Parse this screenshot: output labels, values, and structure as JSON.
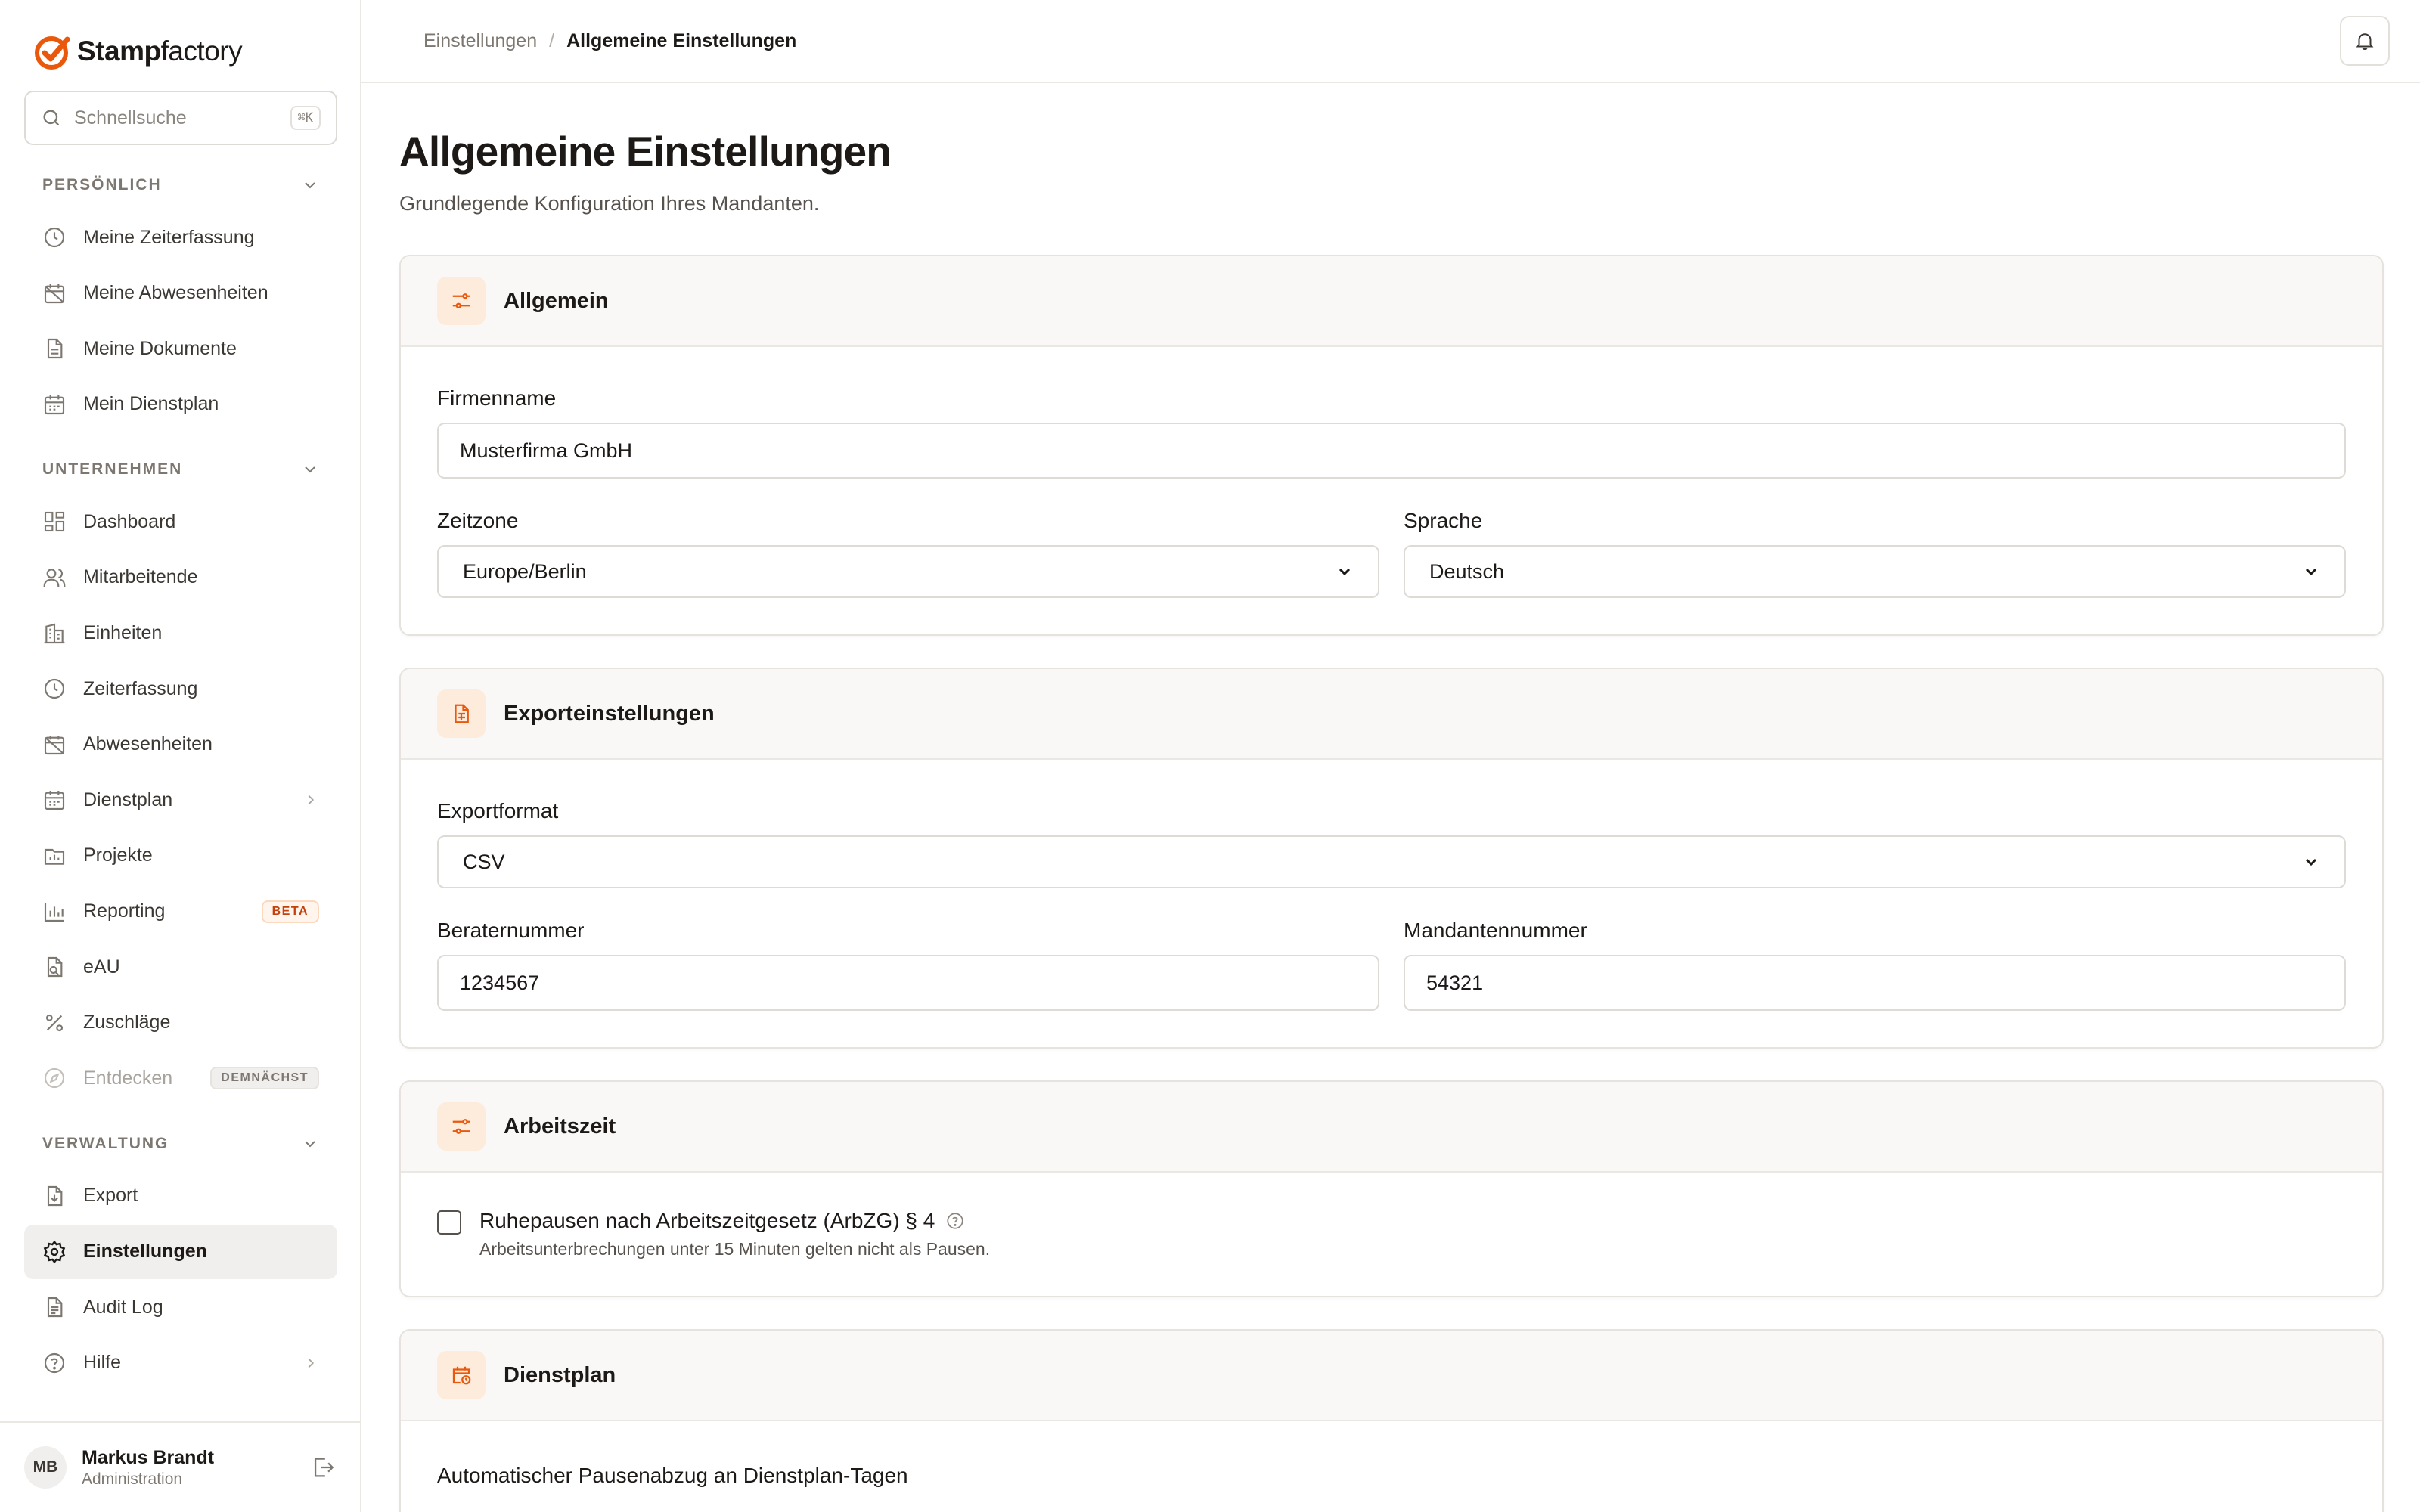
{
  "brand": {
    "name_bold": "Stamp",
    "name_light": "factory",
    "accent": "#ea580c"
  },
  "search": {
    "placeholder": "Schnellsuche",
    "shortcut": "⌘K"
  },
  "sidebar": {
    "sections": [
      {
        "title": "PERSÖNLICH",
        "items": [
          {
            "label": "Meine Zeiterfassung",
            "icon": "clock-icon"
          },
          {
            "label": "Meine Abwesenheiten",
            "icon": "calendar-off-icon"
          },
          {
            "label": "Meine Dokumente",
            "icon": "document-icon"
          },
          {
            "label": "Mein Dienstplan",
            "icon": "calendar-icon"
          }
        ]
      },
      {
        "title": "UNTERNEHMEN",
        "items": [
          {
            "label": "Dashboard",
            "icon": "dashboard-icon"
          },
          {
            "label": "Mitarbeitende",
            "icon": "users-icon"
          },
          {
            "label": "Einheiten",
            "icon": "building-icon"
          },
          {
            "label": "Zeiterfassung",
            "icon": "clock-icon"
          },
          {
            "label": "Abwesenheiten",
            "icon": "calendar-off-icon"
          },
          {
            "label": "Dienstplan",
            "icon": "calendar-icon"
          },
          {
            "label": "Projekte",
            "icon": "folder-icon"
          },
          {
            "label": "Reporting",
            "icon": "bar-chart-icon",
            "badge": "BETA"
          },
          {
            "label": "eAU",
            "icon": "file-check-icon"
          },
          {
            "label": "Zuschläge",
            "icon": "percent-icon"
          },
          {
            "label": "Entdecken",
            "icon": "compass-icon",
            "badge": "DEMNÄCHST"
          }
        ]
      },
      {
        "title": "VERWALTUNG",
        "items": [
          {
            "label": "Export",
            "icon": "file-export-icon"
          },
          {
            "label": "Einstellungen",
            "icon": "gear-icon",
            "active": true
          },
          {
            "label": "Audit Log",
            "icon": "log-icon"
          },
          {
            "label": "Hilfe",
            "icon": "help-icon"
          }
        ]
      }
    ]
  },
  "user": {
    "initials": "MB",
    "name": "Markus Brandt",
    "role": "Administration"
  },
  "breadcrumb": {
    "parent": "Einstellungen",
    "separator": "/",
    "current": "Allgemeine Einstellungen"
  },
  "page": {
    "title": "Allgemeine Einstellungen",
    "subtitle": "Grundlegende Konfiguration Ihres Mandanten."
  },
  "cards": {
    "general": {
      "title": "Allgemein",
      "company_label": "Firmenname",
      "company_value": "Musterfirma GmbH",
      "timezone_label": "Zeitzone",
      "timezone_value": "Europe/Berlin",
      "language_label": "Sprache",
      "language_value": "Deutsch"
    },
    "export": {
      "title": "Exporteinstellungen",
      "format_label": "Exportformat",
      "format_value": "CSV",
      "advisor_label": "Beraternummer",
      "advisor_value": "1234567",
      "client_label": "Mandantennummer",
      "client_value": "54321"
    },
    "worktime": {
      "title": "Arbeitszeit",
      "break_label": "Ruhepausen nach Arbeitszeitgesetz (ArbZG) § 4",
      "break_desc": "Arbeitsunterbrechungen unter 15 Minuten gelten nicht als Pausen."
    },
    "roster": {
      "title": "Dienstplan",
      "auto_break_label": "Automatischer Pausenabzug an Dienstplan-Tagen"
    }
  }
}
